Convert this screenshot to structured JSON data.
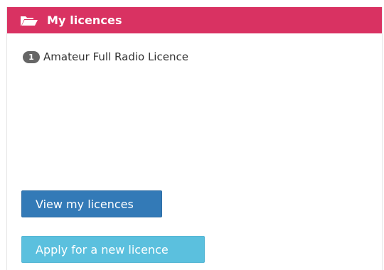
{
  "panel": {
    "title": "My licences",
    "icon": "folder-open-icon",
    "header_color": "#d93262"
  },
  "licences": [
    {
      "count": "1",
      "name": "Amateur Full Radio Licence"
    }
  ],
  "buttons": {
    "view_label": "View my licences",
    "apply_label": "Apply for a new licence"
  },
  "colors": {
    "primary": "#337ab7",
    "info": "#5bc0de",
    "badge": "#666666"
  }
}
